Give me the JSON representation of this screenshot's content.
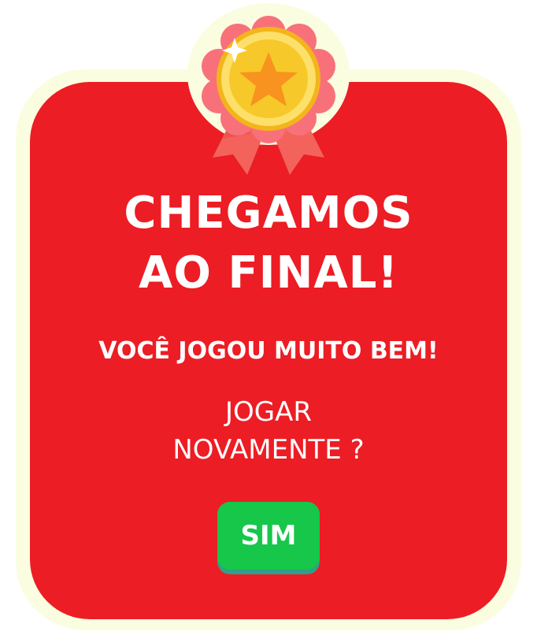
{
  "dialog": {
    "title_line1": "CHEGAMOS",
    "title_line2": "AO FINAL!",
    "subtitle": "VOCÊ JOGOU MUITO BEM!",
    "question_line1": "JOGAR",
    "question_line2": "NOVAMENTE ?",
    "yes_button_label": "SIM"
  },
  "colors": {
    "panel": "#ec1d24",
    "frame": "#fbfde0",
    "button": "#16c749",
    "button_shadow": "#2f9f8b",
    "medal_gold": "#f7c829",
    "medal_star": "#f7931e",
    "ribbon": "#f4625c"
  },
  "icons": {
    "medal": "medal-star-icon",
    "sparkle": "sparkle-icon"
  }
}
